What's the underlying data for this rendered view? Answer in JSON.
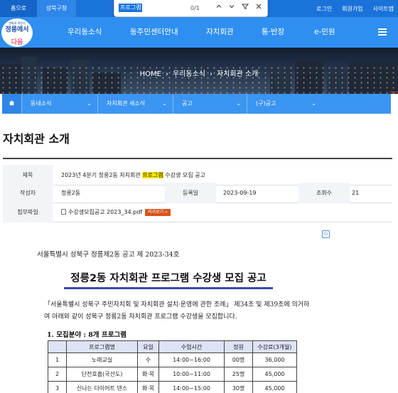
{
  "topbar": {
    "home": "홈으로",
    "gu": "성북구청",
    "links": [
      "로그인",
      "회원가입",
      "사이트맵"
    ]
  },
  "findbar": {
    "query": "프로그램",
    "count": "0/1"
  },
  "logo": {
    "small": "변화와 희망의",
    "main": "정릉에서",
    "sub": "다음"
  },
  "nav": {
    "items": [
      "우리동소식",
      "동주민센터안내",
      "자치회관",
      "통·반장",
      "e-민원"
    ]
  },
  "hero": {
    "breadcrumb": [
      "HOME",
      "우리동소식",
      "자치회관 소개"
    ]
  },
  "subnav": {
    "items": [
      "동네소식",
      "자치회관 새소식",
      "공고",
      "(구)공고"
    ]
  },
  "page": {
    "title": "자치회관 소개"
  },
  "post": {
    "labels": {
      "title": "제목",
      "author": "작성자",
      "date": "등록일",
      "views": "조회수",
      "attachment": "첨부파일"
    },
    "title_before": "2023년 4분기 정릉2동 자치회관 ",
    "title_highlight": "프로그램",
    "title_after": " 수강생 모집 공고",
    "author": "정릉2동",
    "date": "2023-09-19",
    "views": "21",
    "attachment": "수강생모집공고 2023_34.pdf",
    "preview": "미리보기"
  },
  "document": {
    "notice_no": "서울특별시 성북구 정릉제2동 공고 제 2023-34호",
    "title": "정릉2동 자치회관 프로그램 수강생 모집 공고",
    "paragraph": "「서울특별시 성북구 주민자치회 및 자치회관 설치·운영에 관한 조례」 제34조 및 제39조에 의거하여 아래와 같이 성북구 정릉2동 자치회관 프로그램 수강생을 모집합니다.",
    "section": "1. 모집분야 : 8개 프로그램",
    "table": {
      "headers": [
        "",
        "프로그램명",
        "요일",
        "수업시간",
        "정원",
        "수강료(3개월)"
      ],
      "rows": [
        [
          "1",
          "노래교실",
          "수",
          "14:00~16:00",
          "00명",
          "36,000"
        ],
        [
          "2",
          "단전호흡(국선도)",
          "화·목",
          "10:00~11:00",
          "25명",
          "45,000"
        ],
        [
          "3",
          "신나는 다이어트 댄스",
          "화·목",
          "14:00~15:00",
          "30명",
          "45,000"
        ]
      ]
    }
  }
}
